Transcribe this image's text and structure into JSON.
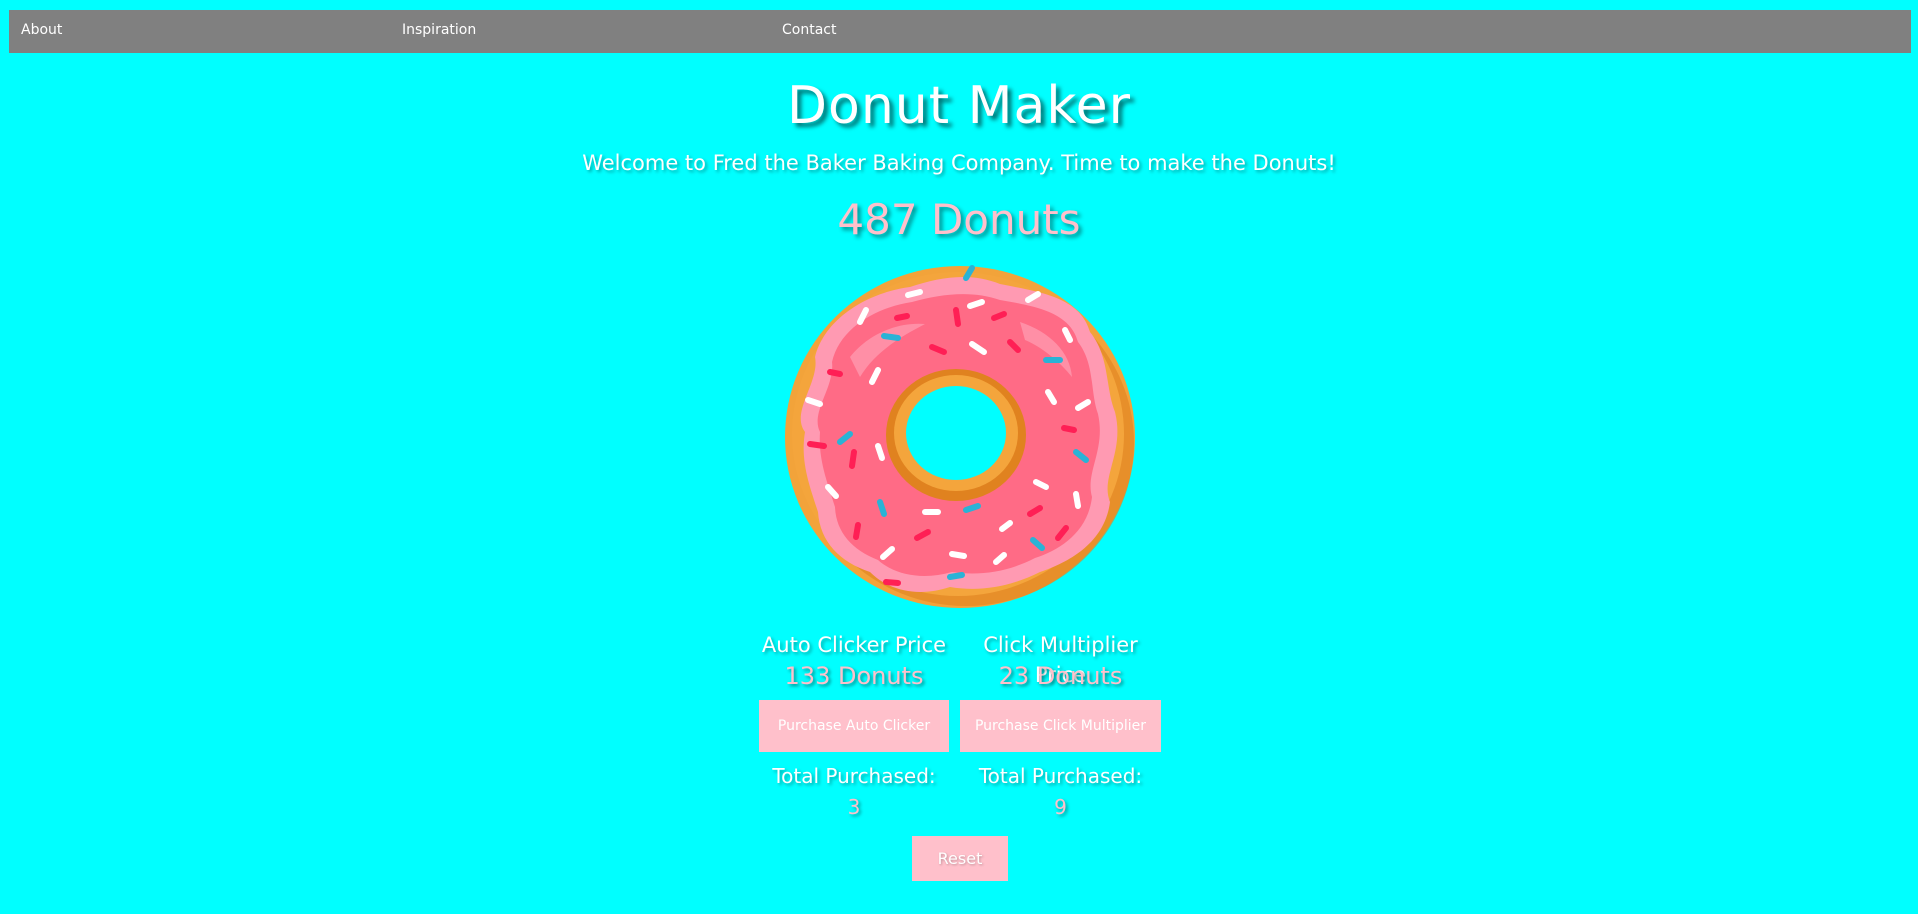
{
  "nav": {
    "about": "About",
    "inspiration": "Inspiration",
    "contact": "Contact"
  },
  "header": {
    "title": "Donut Maker",
    "welcome": "Welcome to Fred the Baker Baking Company. Time to make the Donuts!"
  },
  "counter": {
    "donuts": "487 Donuts"
  },
  "auto_clicker": {
    "price_label": "Auto Clicker Price",
    "price_value": "133 Donuts",
    "button_label": "Purchase Auto Clicker",
    "total_label": "Total Purchased:",
    "total_value": "3"
  },
  "click_multiplier": {
    "price_label": "Click Multiplier Price",
    "price_value": "23 Donuts",
    "button_label": "Purchase Click Multiplier",
    "total_label": "Total Purchased:",
    "total_value": "9"
  },
  "actions": {
    "reset_label": "Reset"
  },
  "colors": {
    "background": "#00ffff",
    "navbar": "#808080",
    "accent_pink": "#ffc0cb",
    "text_white": "#ffffff"
  },
  "icons": {
    "donut": "donut-icon"
  }
}
